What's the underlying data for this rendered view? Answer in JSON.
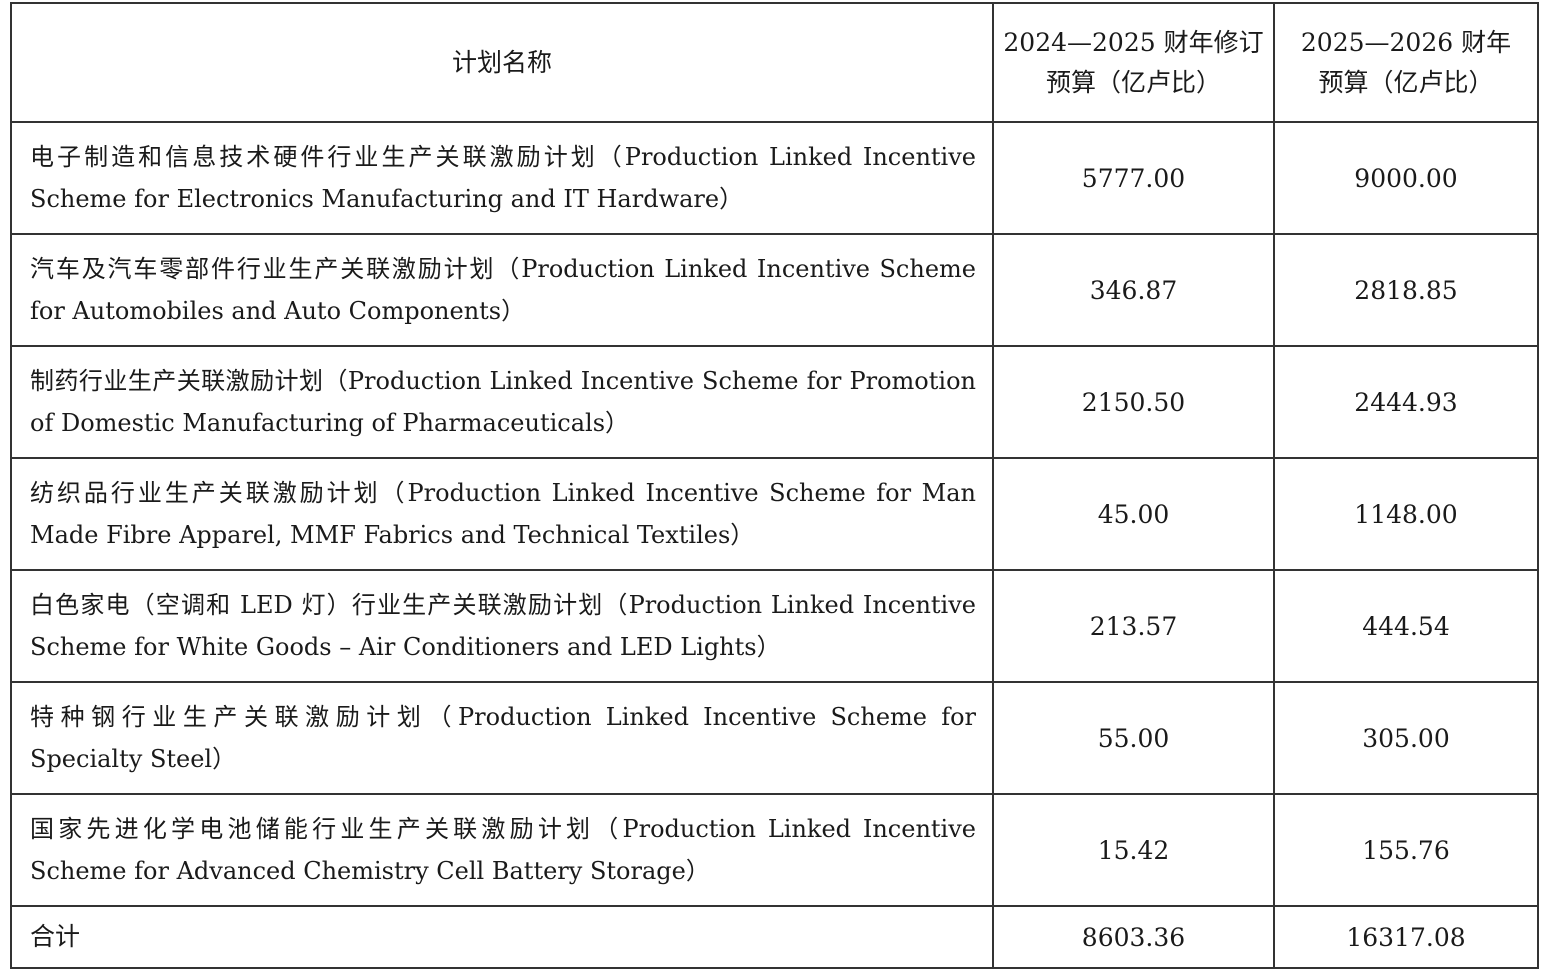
{
  "table": {
    "headers": {
      "name": "计划名称",
      "col1_line1": "2024—2025 财年修订",
      "col1_line2": "预算（亿卢比）",
      "col2_line1": "2025—2026 财年",
      "col2_line2": "预算（亿卢比）"
    },
    "rows": [
      {
        "name": "电子制造和信息技术硬件行业生产关联激励计划（Production Linked Incentive Scheme for Electronics Manufacturing and IT Hardware）",
        "revised_2024_2025": "5777.00",
        "budget_2025_2026": "9000.00"
      },
      {
        "name": "汽车及汽车零部件行业生产关联激励计划（Production Linked Incentive Scheme for Automobiles and Auto Components）",
        "revised_2024_2025": "346.87",
        "budget_2025_2026": "2818.85"
      },
      {
        "name": "制药行业生产关联激励计划（Production Linked Incentive Scheme for Promotion of Domestic Manufacturing of Pharmaceuticals）",
        "revised_2024_2025": "2150.50",
        "budget_2025_2026": "2444.93"
      },
      {
        "name": "纺织品行业生产关联激励计划（Production Linked Incentive Scheme for Man Made Fibre Apparel, MMF Fabrics and Technical Textiles）",
        "revised_2024_2025": "45.00",
        "budget_2025_2026": "1148.00"
      },
      {
        "name": "白色家电（空调和 LED 灯）行业生产关联激励计划（Production Linked Incentive Scheme for White Goods – Air Conditioners and LED Lights）",
        "revised_2024_2025": "213.57",
        "budget_2025_2026": "444.54"
      },
      {
        "name": "特种钢行业生产关联激励计划（Production Linked Incentive Scheme for Specialty Steel）",
        "revised_2024_2025": "55.00",
        "budget_2025_2026": "305.00"
      },
      {
        "name": "国家先进化学电池储能行业生产关联激励计划（Production Linked Incentive Scheme for Advanced Chemistry Cell Battery Storage）",
        "revised_2024_2025": "15.42",
        "budget_2025_2026": "155.76"
      }
    ],
    "total": {
      "label": "合计",
      "revised_2024_2025": "8603.36",
      "budget_2025_2026": "16317.08"
    }
  }
}
